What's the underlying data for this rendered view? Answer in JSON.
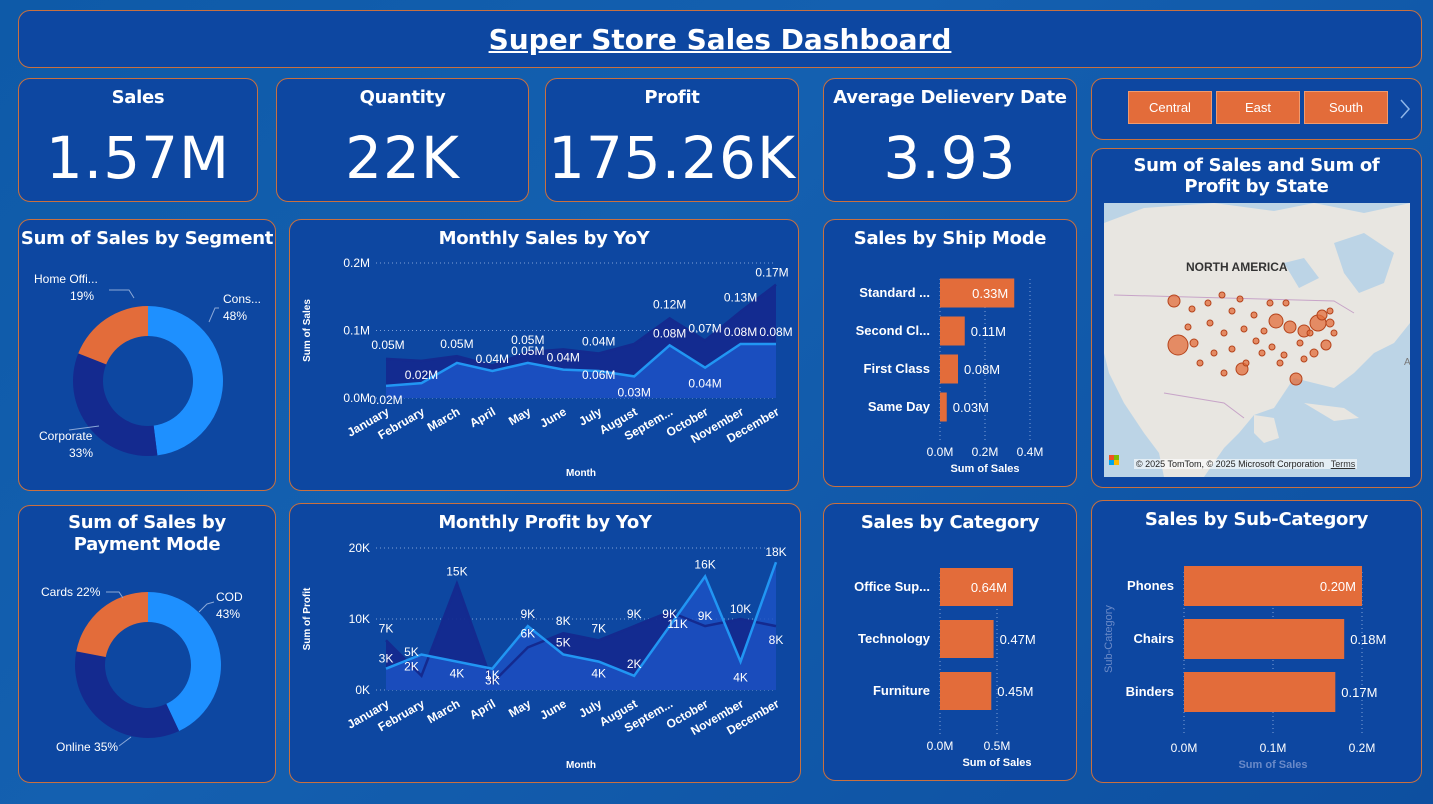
{
  "header": {
    "title": "Super Store Sales Dashboard"
  },
  "kpis": {
    "sales": {
      "label": "Sales",
      "value": "1.57M"
    },
    "quantity": {
      "label": "Quantity",
      "value": "22K"
    },
    "profit": {
      "label": "Profit",
      "value": "175.26K"
    },
    "delivery": {
      "label": "Average Delievery Date",
      "value": "3.93"
    }
  },
  "slicer": {
    "items": [
      "Central",
      "East",
      "South"
    ],
    "next_icon": "chevron-right-icon"
  },
  "map": {
    "title": "Sum of Sales and Sum of Profit by State",
    "region_label": "NORTH AMERICA",
    "attribution": "© 2025 TomTom, © 2025 Microsoft Corporation",
    "terms": "Terms",
    "logo": "Microsoft"
  },
  "colors": {
    "accent": "#e36c3a",
    "series_light": "#1e90ff",
    "series_dark": "#142a8f",
    "card_bg": "#0d47a1"
  },
  "chart_data": [
    {
      "id": "segment",
      "type": "pie",
      "title": "Sum of Sales by Segment",
      "slices": [
        {
          "label": "Cons...",
          "pct_label": "48%",
          "value": 48,
          "color": "#1e90ff"
        },
        {
          "label": "Corporate",
          "pct_label": "33%",
          "value": 33,
          "color": "#142a8f"
        },
        {
          "label": "Home Offi...",
          "pct_label": "19%",
          "value": 19,
          "color": "#e36c3a"
        }
      ]
    },
    {
      "id": "payment",
      "type": "pie",
      "title": "Sum of Sales by Payment Mode",
      "slices": [
        {
          "label": "COD",
          "pct_label": "43%",
          "value": 43,
          "color": "#1e90ff"
        },
        {
          "label": "Online",
          "pct_label": "35%",
          "value": 35,
          "color": "#142a8f"
        },
        {
          "label": "Cards",
          "pct_label": "22%",
          "value": 22,
          "color": "#e36c3a"
        }
      ]
    },
    {
      "id": "monthly_sales",
      "type": "area",
      "title": "Monthly Sales by YoY",
      "xlabel": "Month",
      "ylabel": "Sum of Sales",
      "categories": [
        "January",
        "February",
        "March",
        "April",
        "May",
        "June",
        "July",
        "August",
        "Septem...",
        "October",
        "November",
        "December"
      ],
      "yticks": [
        "0.0M",
        "0.1M",
        "0.2M"
      ],
      "ylim": [
        0,
        0.2
      ],
      "series": [
        {
          "values": [
            0.058,
            0.055,
            0.062,
            0.048,
            0.068,
            0.072,
            0.066,
            0.08,
            0.118,
            0.085,
            0.128,
            0.168
          ],
          "labels": [
            "0.05M",
            "0.02M",
            "0.05M",
            "",
            "0.05M",
            "",
            "0.04M",
            "",
            "0.12M",
            "0.07M",
            "0.13M",
            "0.17M"
          ]
        },
        {
          "values": [
            0.018,
            0.022,
            0.052,
            0.04,
            0.052,
            0.042,
            0.04,
            0.032,
            0.078,
            0.045,
            0.08,
            0.08
          ],
          "labels": [
            "0.02M",
            "",
            "",
            "0.04M",
            "0.05M",
            "0.04M",
            "0.06M",
            "0.03M",
            "0.08M",
            "0.04M",
            "0.08M",
            "0.08M"
          ]
        }
      ]
    },
    {
      "id": "monthly_profit",
      "type": "area",
      "title": "Monthly Profit by YoY",
      "xlabel": "Month",
      "ylabel": "Sum of Profit",
      "categories": [
        "January",
        "February",
        "March",
        "April",
        "May",
        "June",
        "July",
        "August",
        "Septem...",
        "October",
        "November",
        "December"
      ],
      "yticks": [
        "0K",
        "10K",
        "20K"
      ],
      "ylim": [
        0,
        20
      ],
      "series": [
        {
          "values": [
            7,
            2,
            15,
            1,
            6,
            8,
            7,
            9,
            11,
            9,
            10,
            9
          ],
          "labels": [
            "7K",
            "5K",
            "15K",
            "1K",
            "6K",
            "8K",
            "7K",
            "9K",
            "11K",
            "9K",
            "10K",
            "8K"
          ]
        },
        {
          "values": [
            3,
            5,
            4,
            3,
            9,
            5,
            4,
            2,
            9,
            16,
            4,
            18
          ],
          "labels": [
            "3K",
            "2K",
            "4K",
            "3K",
            "9K",
            "5K",
            "4K",
            "2K",
            "9K",
            "16K",
            "4K",
            "18K"
          ]
        }
      ]
    },
    {
      "id": "ship_mode",
      "type": "bar",
      "title": "Sales by Ship Mode",
      "xlabel": "Sum of Sales",
      "categories": [
        "Standard ...",
        "Second Cl...",
        "First Class",
        "Same Day"
      ],
      "values": [
        0.33,
        0.11,
        0.08,
        0.03
      ],
      "labels": [
        "0.33M",
        "0.11M",
        "0.08M",
        "0.03M"
      ],
      "xticks": [
        "0.0M",
        "0.2M",
        "0.4M"
      ],
      "xlim": [
        0,
        0.4
      ]
    },
    {
      "id": "category",
      "type": "bar",
      "title": "Sales by Category",
      "xlabel": "Sum of Sales",
      "categories": [
        "Office Sup...",
        "Technology",
        "Furniture"
      ],
      "values": [
        0.64,
        0.47,
        0.45
      ],
      "labels": [
        "0.64M",
        "0.47M",
        "0.45M"
      ],
      "xticks": [
        "0.0M",
        "0.5M"
      ],
      "xlim": [
        0,
        1.0
      ]
    },
    {
      "id": "subcategory",
      "type": "bar",
      "title": "Sales by Sub-Category",
      "xlabel": "Sum of Sales",
      "ylabel": "Sub-Category",
      "categories": [
        "Phones",
        "Chairs",
        "Binders"
      ],
      "values": [
        0.2,
        0.18,
        0.17
      ],
      "labels": [
        "0.20M",
        "0.18M",
        "0.17M"
      ],
      "xticks": [
        "0.0M",
        "0.1M",
        "0.2M"
      ],
      "xlim": [
        0,
        0.2
      ]
    }
  ]
}
